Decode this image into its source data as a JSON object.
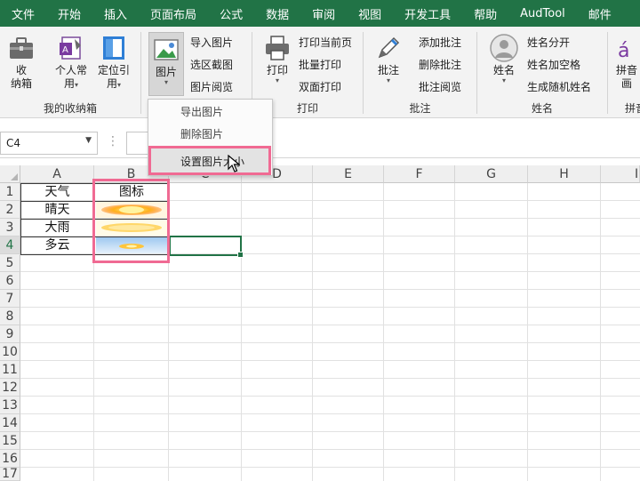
{
  "menu": [
    "文件",
    "开始",
    "插入",
    "页面布局",
    "公式",
    "数据",
    "审阅",
    "视图",
    "开发工具",
    "帮助",
    "AudTool",
    "邮件"
  ],
  "ribbon": {
    "group1": {
      "label": "我的收纳箱",
      "btn_box_l1": "收",
      "btn_box_l2": "纳箱",
      "btn_personal_l1": "个人常",
      "btn_personal_l2": "用",
      "btn_locate_l1": "定位引",
      "btn_locate_l2": "用"
    },
    "group2": {
      "btn_picture": "图片",
      "import": "导入图片",
      "region_shot": "选区截图",
      "browse": "图片阅览"
    },
    "group3": {
      "label": "打印",
      "btn_print": "打印",
      "print_current": "打印当前页",
      "batch_print": "批量打印",
      "duplex": "双面打印"
    },
    "group4": {
      "label": "批注",
      "btn_comment": "批注",
      "add": "添加批注",
      "delete": "删除批注",
      "browse": "批注阅览"
    },
    "group5": {
      "label": "姓名",
      "btn_name": "姓名",
      "split": "姓名分开",
      "add_space": "姓名加空格",
      "random": "生成随机姓名"
    },
    "group6": {
      "label": "拼音",
      "btn_pinyin_l1": "拼音",
      "btn_pinyin_l2": "画"
    }
  },
  "dropdown": {
    "export": "导出图片",
    "delete": "删除图片",
    "resize": "设置图片大小"
  },
  "formula": {
    "namebox": "C4",
    "dots": "⋮"
  },
  "columns": [
    "A",
    "B",
    "C",
    "D",
    "E",
    "F",
    "G",
    "H",
    "I"
  ],
  "rows": [
    "1",
    "2",
    "3",
    "4",
    "5",
    "6",
    "7",
    "8",
    "9",
    "10",
    "11",
    "12",
    "13",
    "14",
    "15",
    "16",
    "17"
  ],
  "cells": {
    "a1": "天气",
    "b1": "图标",
    "a2": "晴天",
    "a3": "大雨",
    "a4": "多云"
  },
  "colors": {
    "brand": "#217346",
    "highlight": "#f06a93"
  }
}
